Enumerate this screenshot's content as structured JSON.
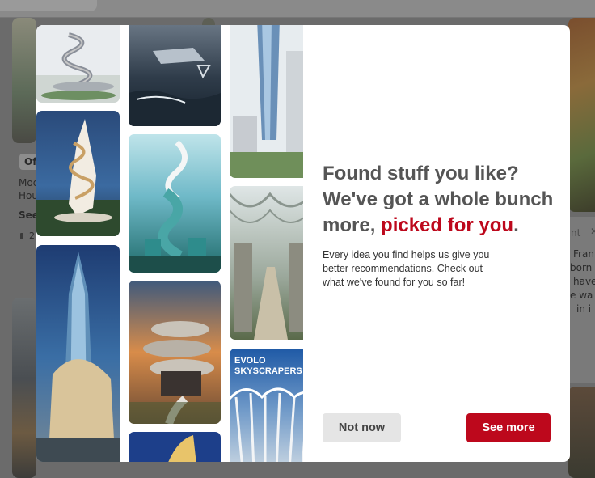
{
  "modal": {
    "headline_lead": "Found stuff you like? We've got a whole bunch more, ",
    "headline_accent": "picked for you",
    "headline_tail": ".",
    "body": "Every idea you find helps us give you better recommendations. Check out what we've found for you so far!",
    "buttons": {
      "secondary": "Not now",
      "primary": "See more"
    }
  },
  "collage": {
    "pins": [
      {
        "name": "spiral-tower-pin",
        "icon": "spiral-tower-image"
      },
      {
        "name": "tornado-tower-pin",
        "icon": "twisted-tower-image"
      },
      {
        "name": "glass-skyscraper-pin",
        "icon": "glass-skyscraper-image"
      },
      {
        "name": "ocean-structure-pin",
        "icon": "ocean-architecture-image"
      },
      {
        "name": "helix-sculpture-pin",
        "icon": "helix-tower-image"
      },
      {
        "name": "spiral-house-pin",
        "icon": "spiral-house-image"
      },
      {
        "name": "twisted-highrise-pin",
        "icon": "twisted-highrise-image"
      },
      {
        "name": "canopy-street-pin",
        "icon": "canopy-street-image"
      },
      {
        "name": "evolo-skyscrapers-pin",
        "icon": "evolo-cover-image"
      },
      {
        "name": "partial-pin",
        "icon": "partial-image"
      }
    ],
    "evolo": {
      "line1": "EVOLO",
      "line2": "SKYSCRAPERS"
    }
  },
  "background": {
    "left_card": {
      "badge": "Of",
      "title_line1": "Mod",
      "title_line2": "Hou",
      "see": "See",
      "count": "2"
    },
    "right_card": {
      "tag": "nt",
      "lines": [
        "Fran",
        "born i",
        "have",
        "e wa",
        "in i"
      ]
    }
  },
  "colors": {
    "accent": "#bd081c",
    "headline": "#555555",
    "overlay": "#6b6b6b"
  }
}
